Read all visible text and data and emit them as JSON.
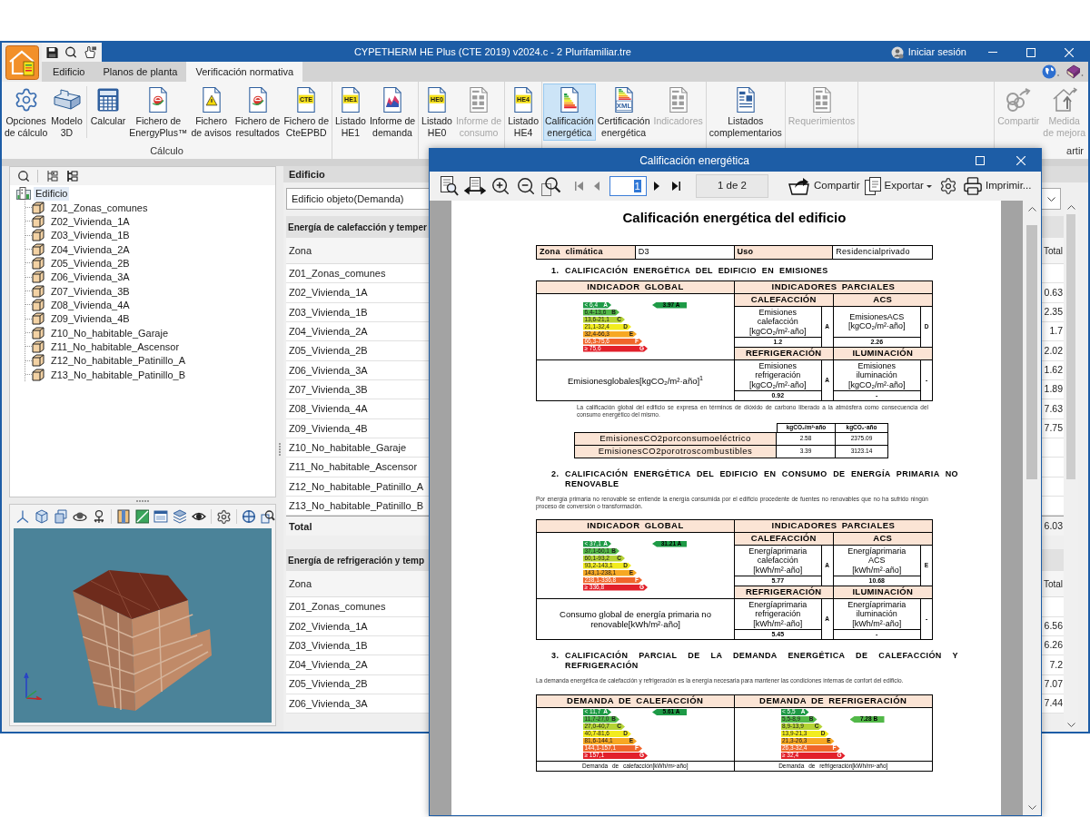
{
  "app_window": {
    "title": "CYPETHERM HE Plus (CTE 2019) v2024.c - 2 Plurifamiliar.tre",
    "sign_in": "Iniciar sesión",
    "tabs": [
      {
        "label": "Edificio",
        "selected": false
      },
      {
        "label": "Planos de planta",
        "selected": false
      },
      {
        "label": "Verificación normativa",
        "selected": true
      }
    ],
    "ribbon": {
      "groups": [
        {
          "label": "Cálculo",
          "sections": [
            [
              {
                "label": "Opciones\nde cálculo",
                "selected": false,
                "disabled": false
              },
              {
                "label": "Modelo\n3D",
                "selected": false,
                "disabled": false
              }
            ],
            [
              {
                "label": "Calcular",
                "selected": false,
                "disabled": false
              },
              {
                "label": "Fichero de\nEnergyPlus™",
                "selected": false,
                "disabled": false
              },
              {
                "label": "Fichero\nde avisos",
                "selected": false,
                "disabled": false
              },
              {
                "label": "Fichero de\nresultados",
                "selected": false,
                "disabled": false
              },
              {
                "label": "Fichero de\nCteEPBD",
                "icon_text": "CTE",
                "selected": false,
                "disabled": false
              }
            ]
          ]
        },
        {
          "sections": [
            [
              {
                "label": "Listado\nHE1",
                "icon_text": "HE1",
                "selected": false,
                "disabled": false
              },
              {
                "label": "Informe de\ndemanda",
                "selected": false,
                "disabled": false
              }
            ]
          ]
        },
        {
          "sections": [
            [
              {
                "label": "Listado\nHE0",
                "icon_text": "HE0",
                "selected": false,
                "disabled": false
              },
              {
                "label": "Informe de\nconsumo",
                "selected": false,
                "disabled": true
              }
            ]
          ]
        },
        {
          "sections": [
            [
              {
                "label": "Listado\nHE4",
                "icon_text": "HE4",
                "selected": false,
                "disabled": false
              }
            ]
          ]
        },
        {
          "sections": [
            [
              {
                "label": "Calificación\nenergética",
                "selected": true,
                "disabled": false
              },
              {
                "label": "Certificación\nenergética",
                "icon_text": "XML",
                "selected": false,
                "disabled": false
              },
              {
                "label": "Indicadores",
                "selected": false,
                "disabled": true
              }
            ]
          ]
        },
        {
          "sections": [
            [
              {
                "label": "Listados\ncomplementarios",
                "selected": false,
                "disabled": false
              }
            ]
          ]
        },
        {
          "sections": [
            [
              {
                "label": "Requerimientos",
                "selected": false,
                "disabled": true
              }
            ]
          ]
        },
        {
          "label": "artir",
          "sections": [
            [
              {
                "label": "Compartir",
                "selected": false,
                "disabled": true
              },
              {
                "label": "Medida\nde mejora",
                "selected": false,
                "disabled": true
              }
            ]
          ]
        }
      ]
    },
    "tree": {
      "root": {
        "label": "Edificio",
        "selected": true,
        "children": [
          {
            "label": "Z01_Zonas_comunes",
            "selected": false
          },
          {
            "label": "Z02_Vivienda_1A",
            "selected": false
          },
          {
            "label": "Z03_Vivienda_1B",
            "selected": false
          },
          {
            "label": "Z04_Vivienda_2A",
            "selected": false
          },
          {
            "label": "Z05_Vivienda_2B",
            "selected": false
          },
          {
            "label": "Z06_Vivienda_3A",
            "selected": false
          },
          {
            "label": "Z07_Vivienda_3B",
            "selected": false
          },
          {
            "label": "Z08_Vivienda_4A",
            "selected": false
          },
          {
            "label": "Z09_Vivienda_4B",
            "selected": false
          },
          {
            "label": "Z10_No_habitable_Garaje",
            "selected": false
          },
          {
            "label": "Z11_No_habitable_Ascensor",
            "selected": false
          },
          {
            "label": "Z12_No_habitable_Patinillo_A",
            "selected": false
          },
          {
            "label": "Z13_No_habitable_Patinillo_B",
            "selected": false
          }
        ]
      }
    },
    "zone_panel": {
      "title": "Edificio",
      "dropdown": "Edificio objeto(Demanda)",
      "tables": [
        {
          "title": "Energía de calefacción y temper",
          "zone_header": "Zona",
          "total_header": "Total",
          "rows": [
            {
              "zone": "Z01_Zonas_comunes"
            },
            {
              "zone": "Z02_Vivienda_1A",
              "total": "0.63"
            },
            {
              "zone": "Z03_Vivienda_1B",
              "total": "2.35"
            },
            {
              "zone": "Z04_Vivienda_2A",
              "total": "1.7"
            },
            {
              "zone": "Z05_Vivienda_2B",
              "total": "2.02"
            },
            {
              "zone": "Z06_Vivienda_3A",
              "total": "1.62"
            },
            {
              "zone": "Z07_Vivienda_3B",
              "total": "1.89"
            },
            {
              "zone": "Z08_Vivienda_4A",
              "total": "7.63"
            },
            {
              "zone": "Z09_Vivienda_4B",
              "total": "7.75"
            },
            {
              "zone": "Z10_No_habitable_Garaje"
            },
            {
              "zone": "Z11_No_habitable_Ascensor"
            },
            {
              "zone": "Z12_No_habitable_Patinillo_A"
            },
            {
              "zone": "Z13_No_habitable_Patinillo_B"
            }
          ],
          "total_row": {
            "label": "Total",
            "total": "6.03"
          }
        },
        {
          "title": "Energía de refrigeración y temp",
          "zone_header": "Zona",
          "total_header": "Total",
          "rows": [
            {
              "zone": "Z01_Zonas_comunes"
            },
            {
              "zone": "Z02_Vivienda_1A",
              "total": "6.56"
            },
            {
              "zone": "Z03_Vivienda_1B",
              "total": "6.26"
            },
            {
              "zone": "Z04_Vivienda_2A",
              "total": "7.2"
            },
            {
              "zone": "Z05_Vivienda_2B",
              "total": "7.07"
            },
            {
              "zone": "Z06_Vivienda_3A",
              "total": "7.44"
            }
          ]
        }
      ]
    }
  },
  "report_window": {
    "title": "Calificación energética",
    "page_field": "1",
    "page_count": "1 de 2",
    "share": "Compartir",
    "export": "Exportar",
    "print": "Imprimir...",
    "document": {
      "title": "Calificación energética del edificio",
      "info": [
        {
          "label": "Zona climática",
          "value": "D3"
        },
        {
          "label": "Uso",
          "value": "Residencialprivado"
        }
      ],
      "sections": [
        {
          "number": "1.",
          "heading": "CALIFICACIÓN ENERGÉTICA DEL EDIFICIO EN EMISIONES",
          "rating_table": {
            "global_header": "INDICADOR GLOBAL",
            "partial_header": "INDICADORES PARCIALES",
            "scale": {
              "indicator": "3.97 A",
              "bars": [
                {
                  "range": "< 6,4",
                  "letter": "A",
                  "color": "#1e9a46",
                  "selected": true
                },
                {
                  "range": "6,4-13,6",
                  "letter": "B",
                  "color": "#52b848",
                  "selected": false
                },
                {
                  "range": "13,6-21,1",
                  "letter": "C",
                  "color": "#b5d334",
                  "selected": false
                },
                {
                  "range": "21,1-32,4",
                  "letter": "D",
                  "color": "#f2ec1f",
                  "selected": false
                },
                {
                  "range": "32,4-66,3",
                  "letter": "E",
                  "color": "#f7a823",
                  "selected": false
                },
                {
                  "range": "66,3-75,6",
                  "letter": "F",
                  "color": "#f0652a",
                  "selected": false
                },
                {
                  "range": "≥ 75,6",
                  "letter": "G",
                  "color": "#e2202b",
                  "selected": false
                }
              ]
            },
            "global_label": "Emisionesglobales[kgCO₂/m²·año]$^{1}$",
            "partials": [
              {
                "header": "CALEFACCIÓN",
                "label": "Emisiones\ncalefacción\n[kgCO₂/m²·año]",
                "class": "A",
                "value": "1.2"
              },
              {
                "header": "ACS",
                "label": "EmisionesACS\n[kgCO₂/m²·año]",
                "class": "D",
                "value": "2.26"
              },
              {
                "header": "REFRIGERACIÓN",
                "label": "Emisiones\nrefrigeración\n[kgCO₂/m²·año]",
                "class": "A",
                "value": "0.92"
              },
              {
                "header": "ILUMINACIÓN",
                "label": "Emisiones\niluminación\n[kgCO₂/m²·año]",
                "class": "-",
                "value": "-"
              }
            ]
          },
          "note": "La calificación global del edificio se expresa en términos de dióxido de carbono liberado a la atmósfera como consecuencia del consumo energético del mismo.",
          "co2_table": {
            "columns": [
              "kgCO₂/m²·año",
              "kgCO₂·año"
            ],
            "rows": [
              {
                "label": "EmisionesCO2porconsumoeléctrico",
                "values": [
                  "2.58",
                  "2375.09"
                ]
              },
              {
                "label": "EmisionesCO2porotroscombustibles",
                "values": [
                  "3.39",
                  "3123.14"
                ]
              }
            ]
          }
        },
        {
          "number": "2.",
          "heading": "CALIFICACIÓN ENERGÉTICA DEL EDIFICIO EN CONSUMO DE ENERGÍA PRIMARIA NO RENOVABLE",
          "intro": "Por energía primaria no renovable se entiende la energía consumida por el edificio procedente de fuentes no renovables que no ha sufrido ningún proceso de conversión o transformación.",
          "rating_table": {
            "global_header": "INDICADOR GLOBAL",
            "partial_header": "INDICADORES PARCIALES",
            "scale": {
              "indicator": "31.21 A",
              "bars": [
                {
                  "range": "< 37,1",
                  "letter": "A",
                  "color": "#1e9a46",
                  "selected": true
                },
                {
                  "range": "37,1-60,1",
                  "letter": "B",
                  "color": "#52b848",
                  "selected": false
                },
                {
                  "range": "60,1-93,2",
                  "letter": "C",
                  "color": "#b5d334",
                  "selected": false
                },
                {
                  "range": "93,2-143,1",
                  "letter": "D",
                  "color": "#f2ec1f",
                  "selected": false
                },
                {
                  "range": "143,1-238,1",
                  "letter": "E",
                  "color": "#f7a823",
                  "selected": false
                },
                {
                  "range": "238,1-336,8",
                  "letter": "F",
                  "color": "#f0652a",
                  "selected": false
                },
                {
                  "range": "≥ 336,8",
                  "letter": "G",
                  "color": "#e2202b",
                  "selected": false
                }
              ]
            },
            "global_label": "Consumo global de energía primaria no\nrenovable[kWh/m²·año]",
            "partials": [
              {
                "header": "CALEFACCIÓN",
                "label": "Energíaprimaria\ncalefacción\n[kWh/m²·año]",
                "class": "A",
                "value": "5.77"
              },
              {
                "header": "ACS",
                "label": "Energíaprimaria\nACS\n[kWh/m²·año]",
                "class": "E",
                "value": "10.68"
              },
              {
                "header": "REFRIGERACIÓN",
                "label": "Energíaprimaria\nrefrigeración\n[kWh/m²·año]",
                "class": "A",
                "value": "5.45"
              },
              {
                "header": "ILUMINACIÓN",
                "label": "Energíaprimaria\niluminación\n[kWh/m²·año]",
                "class": "-",
                "value": "-"
              }
            ]
          }
        },
        {
          "number": "3.",
          "heading": "CALIFICACIÓN PARCIAL DE LA DEMANDA ENERGÉTICA DE CALEFACCIÓN Y REFRIGERACIÓN",
          "intro": "La demanda energética de calefacción y refrigeración es la energía necesaria para mantener las condiciones internas de confort del edificio.",
          "demand_table": {
            "columns": [
              {
                "header": "DEMANDA DE CALEFACCIÓN",
                "scale": {
                  "indicator": "5.61 A",
                  "bars": [
                    {
                      "range": "< 11,7",
                      "letter": "A",
                      "color": "#1e9a46",
                      "selected": true
                    },
                    {
                      "range": "11,7-27,0",
                      "letter": "B",
                      "color": "#52b848",
                      "selected": false
                    },
                    {
                      "range": "27,0-40,7",
                      "letter": "C",
                      "color": "#b5d334",
                      "selected": false
                    },
                    {
                      "range": "40,7-81,6",
                      "letter": "D",
                      "color": "#f2ec1f",
                      "selected": false
                    },
                    {
                      "range": "81,6-144,1",
                      "letter": "E",
                      "color": "#f7a823",
                      "selected": false
                    },
                    {
                      "range": "144,1-157,1",
                      "letter": "F",
                      "color": "#f0652a",
                      "selected": false
                    },
                    {
                      "range": "≥ 157,1",
                      "letter": "G",
                      "color": "#e2202b",
                      "selected": false
                    }
                  ]
                },
                "footer": "Demanda de calefacción[kWh/m²·año]"
              },
              {
                "header": "DEMANDA DE REFRIGERACIÓN",
                "scale": {
                  "indicator": "7.28 B",
                  "bars": [
                    {
                      "range": "< 5,5",
                      "letter": "A",
                      "color": "#1e9a46",
                      "selected": false
                    },
                    {
                      "range": "5,5-8,9",
                      "letter": "B",
                      "color": "#52b848",
                      "selected": true
                    },
                    {
                      "range": "8,9-13,9",
                      "letter": "C",
                      "color": "#b5d334",
                      "selected": false
                    },
                    {
                      "range": "13,9-21,3",
                      "letter": "D",
                      "color": "#f2ec1f",
                      "selected": false
                    },
                    {
                      "range": "21,3-26,3",
                      "letter": "E",
                      "color": "#f7a823",
                      "selected": false
                    },
                    {
                      "range": "26,3-32,4",
                      "letter": "F",
                      "color": "#f0652a",
                      "selected": false
                    },
                    {
                      "range": "≥ 32,4",
                      "letter": "G",
                      "color": "#e2202b",
                      "selected": false
                    }
                  ]
                },
                "footer": "Demanda de refrigeración[kWh/m²·año]"
              }
            ]
          }
        }
      ]
    }
  }
}
